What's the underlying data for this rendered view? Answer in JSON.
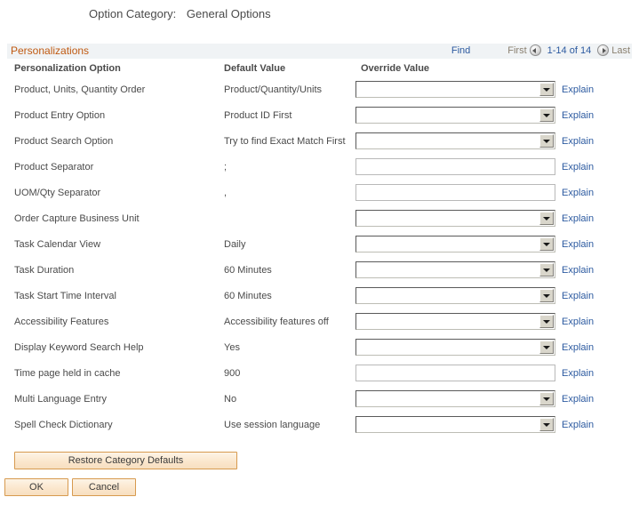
{
  "page": {
    "title_label": "Option Category:",
    "title_value": "General Options"
  },
  "grid": {
    "caption": "Personalizations",
    "nav": {
      "find_label": "Find",
      "first_label": "First",
      "prev_icon": "prev-arrow-icon",
      "range_label": "1-14 of 14",
      "next_icon": "next-arrow-icon",
      "last_label": "Last"
    },
    "columns": {
      "option": "Personalization Option",
      "default": "Default Value",
      "override": "Override Value"
    },
    "explain_label": "Explain",
    "rows": [
      {
        "option": "Product, Units, Quantity Order",
        "default": "Product/Quantity/Units",
        "override_type": "select",
        "override_value": "",
        "explain": "Explain"
      },
      {
        "option": "Product Entry Option",
        "default": "Product ID First",
        "override_type": "select",
        "override_value": "",
        "explain": "Explain"
      },
      {
        "option": "Product Search Option",
        "default": "Try to find Exact Match First",
        "override_type": "select",
        "override_value": "",
        "explain": "Explain"
      },
      {
        "option": "Product Separator",
        "default": ";",
        "override_type": "text",
        "override_value": "",
        "explain": "Explain"
      },
      {
        "option": "UOM/Qty Separator",
        "default": ",",
        "override_type": "text",
        "override_value": "",
        "explain": "Explain"
      },
      {
        "option": "Order Capture Business Unit",
        "default": "",
        "override_type": "select",
        "override_value": "",
        "explain": "Explain"
      },
      {
        "option": "Task Calendar View",
        "default": "Daily",
        "override_type": "select",
        "override_value": "",
        "explain": "Explain"
      },
      {
        "option": "Task Duration",
        "default": "60 Minutes",
        "override_type": "select",
        "override_value": "",
        "explain": "Explain"
      },
      {
        "option": "Task Start Time Interval",
        "default": "60 Minutes",
        "override_type": "select",
        "override_value": "",
        "explain": "Explain"
      },
      {
        "option": "Accessibility Features",
        "default": "Accessibility features off",
        "override_type": "select",
        "override_value": "",
        "explain": "Explain"
      },
      {
        "option": "Display Keyword Search Help",
        "default": "Yes",
        "override_type": "select",
        "override_value": "",
        "explain": "Explain"
      },
      {
        "option": "Time page held in cache",
        "default": "900",
        "override_type": "text",
        "override_value": "",
        "explain": "Explain"
      },
      {
        "option": "Multi Language Entry",
        "default": "No",
        "override_type": "select",
        "override_value": "",
        "explain": "Explain"
      },
      {
        "option": "Spell Check Dictionary",
        "default": "Use session language",
        "override_type": "select",
        "override_value": "",
        "explain": "Explain"
      }
    ]
  },
  "actions": {
    "restore_defaults": "Restore Category Defaults",
    "ok": "OK",
    "cancel": "Cancel"
  },
  "colors": {
    "grid_caption": "#c05a12",
    "link": "#2c5aa0",
    "grid_bar_bg": "#f0f3f5",
    "button_border": "#d79a4f"
  }
}
